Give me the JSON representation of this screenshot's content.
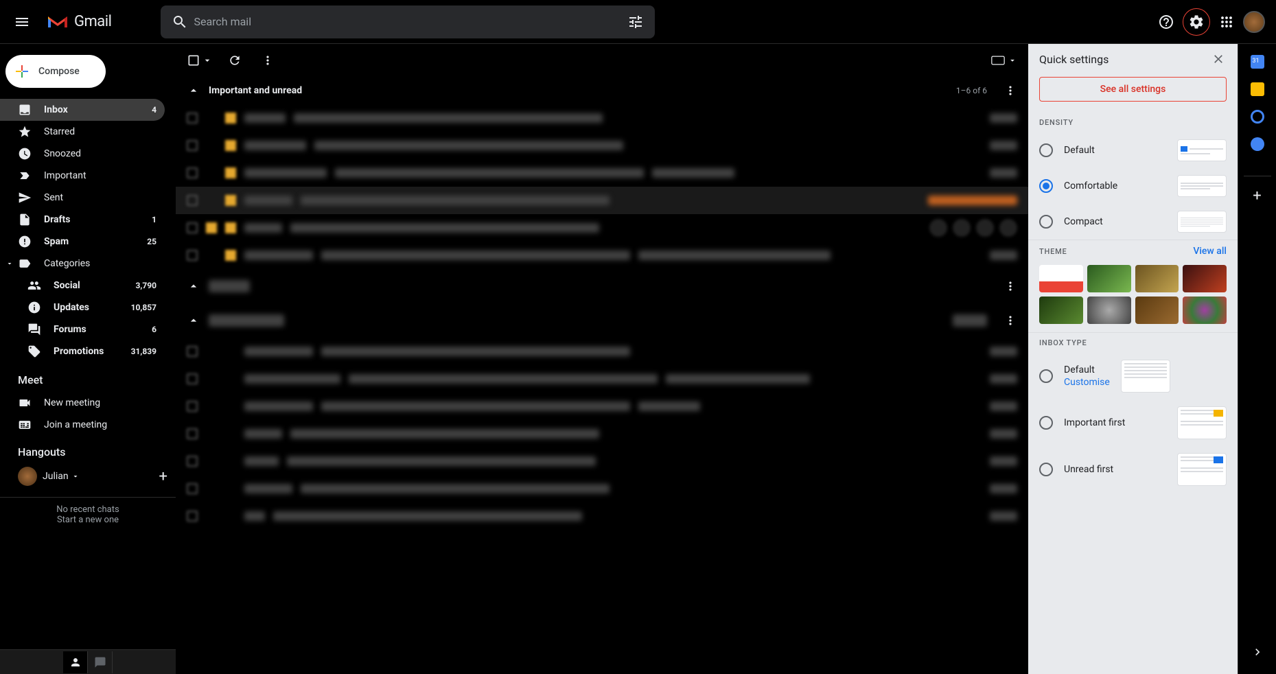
{
  "header": {
    "logo_text": "Gmail",
    "search_placeholder": "Search mail"
  },
  "compose": {
    "label": "Compose"
  },
  "nav": {
    "inbox": {
      "label": "Inbox",
      "count": "4"
    },
    "starred": {
      "label": "Starred"
    },
    "snoozed": {
      "label": "Snoozed"
    },
    "important": {
      "label": "Important"
    },
    "sent": {
      "label": "Sent"
    },
    "drafts": {
      "label": "Drafts",
      "count": "1"
    },
    "spam": {
      "label": "Spam",
      "count": "25"
    },
    "categories": {
      "label": "Categories"
    },
    "social": {
      "label": "Social",
      "count": "3,790"
    },
    "updates": {
      "label": "Updates",
      "count": "10,857"
    },
    "forums": {
      "label": "Forums",
      "count": "6"
    },
    "promotions": {
      "label": "Promotions",
      "count": "31,839"
    }
  },
  "meet": {
    "header": "Meet",
    "new_meeting": "New meeting",
    "join_meeting": "Join a meeting"
  },
  "hangouts": {
    "header": "Hangouts",
    "user": "Julian",
    "no_chats": "No recent chats",
    "start_new": "Start a new one"
  },
  "main": {
    "section1_title": "Important and unread",
    "section1_count": "1–6 of 6"
  },
  "settings": {
    "title": "Quick settings",
    "see_all": "See all settings",
    "density_title": "DENSITY",
    "density": {
      "default": "Default",
      "comfortable": "Comfortable",
      "compact": "Compact"
    },
    "theme_title": "THEME",
    "view_all": "View all",
    "inbox_type_title": "INBOX TYPE",
    "inbox": {
      "default": "Default",
      "customise": "Customise",
      "important_first": "Important first",
      "unread_first": "Unread first"
    }
  }
}
